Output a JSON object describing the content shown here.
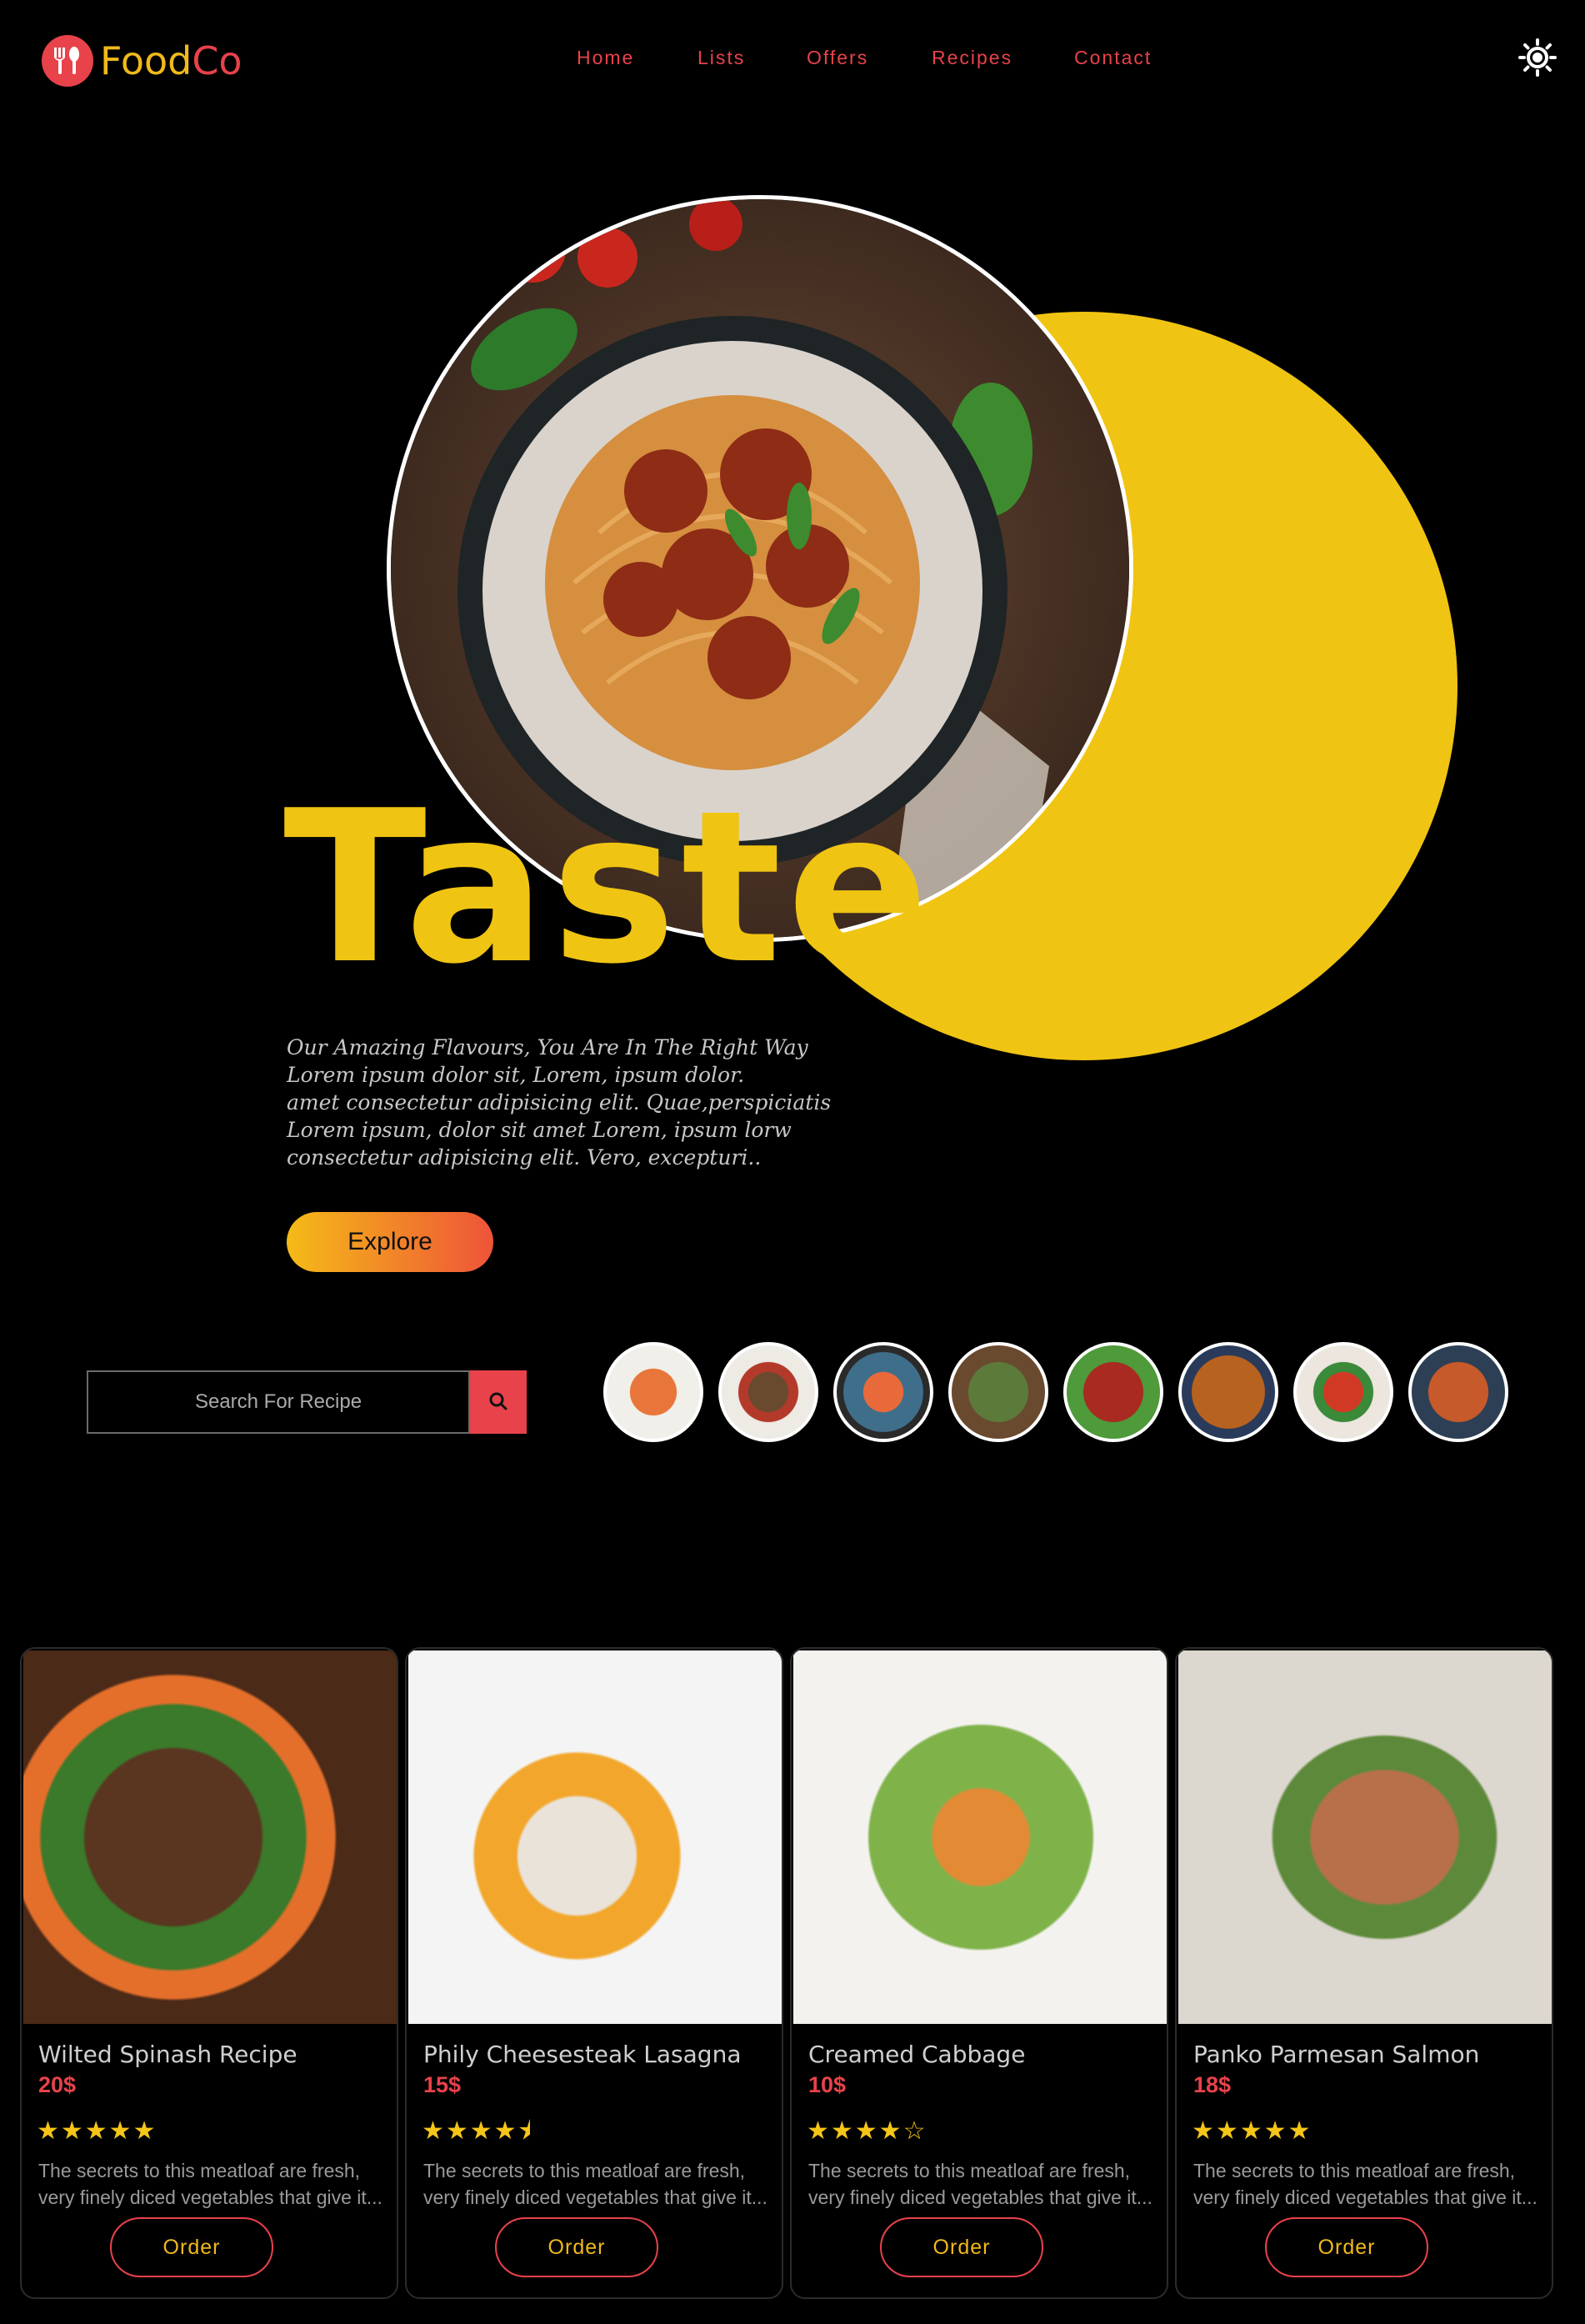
{
  "brand": {
    "name_part1": "Food",
    "name_part2": "Co"
  },
  "nav": {
    "items": [
      {
        "label": "Home"
      },
      {
        "label": "Lists"
      },
      {
        "label": "Offers"
      },
      {
        "label": "Recipes"
      },
      {
        "label": "Contact"
      }
    ],
    "theme_icon": "sun-icon"
  },
  "hero": {
    "title": "Taste",
    "description_lines": [
      "Our Amazing Flavours, You Are In The Right Way",
      "Lorem ipsum dolor sit, Lorem, ipsum dolor.",
      "amet consectetur adipisicing elit. Quae,perspiciatis",
      "Lorem ipsum, dolor sit amet Lorem, ipsum lorw",
      "consectetur adipisicing elit. Vero, excepturi.."
    ],
    "button_label": "Explore"
  },
  "search": {
    "placeholder": "Search For Recipe",
    "icon": "search-icon"
  },
  "thumbnails": [
    "carrot-dish",
    "skewers-dish",
    "rolls-dish",
    "salad-dish",
    "sausage-dish",
    "nuggets-dish",
    "stir-fry-dish",
    "pasta-dish"
  ],
  "cards": [
    {
      "title": "Wilted Spinash Recipe",
      "price": "20$",
      "rating": 5,
      "stars": "★★★★★",
      "description": "The secrets to this meatloaf are fresh, very finely diced vegetables that give it...",
      "order_label": "Order"
    },
    {
      "title": "Phily Cheesesteak Lasagna",
      "price": "15$",
      "rating": 4.5,
      "stars": "★★★★⯨",
      "description": "The secrets to this meatloaf are fresh, very finely diced vegetables that give it...",
      "order_label": "Order"
    },
    {
      "title": "Creamed Cabbage",
      "price": "10$",
      "rating": 4,
      "stars": "★★★★☆",
      "description": "The secrets to this meatloaf are fresh, very finely diced vegetables that give it...",
      "order_label": "Order"
    },
    {
      "title": "Panko Parmesan Salmon",
      "price": "18$",
      "rating": 5,
      "stars": "★★★★★",
      "description": "The secrets to this meatloaf are fresh, very finely diced vegetables that give it...",
      "order_label": "Order"
    }
  ],
  "colors": {
    "accent_red": "#e8424a",
    "accent_yellow": "#f0c412",
    "background": "#000000"
  }
}
